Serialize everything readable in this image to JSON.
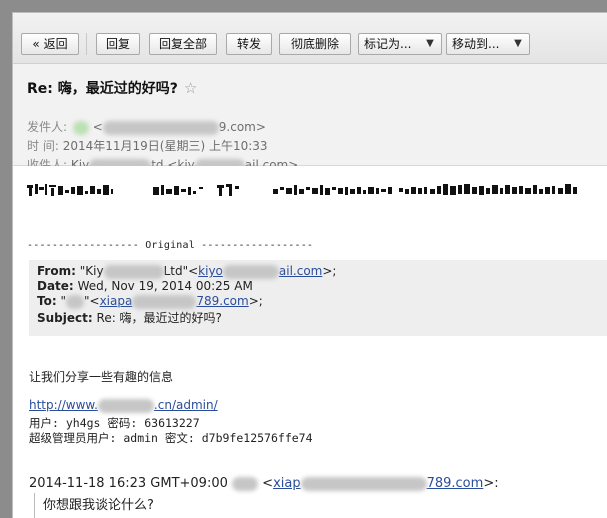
{
  "toolbar": {
    "back_label": "« 返回",
    "reply_label": "回复",
    "reply_all_label": "回复全部",
    "forward_label": "转发",
    "delete_label": "彻底删除",
    "mark_as_label": "标记为...",
    "move_to_label": "移动到..."
  },
  "header": {
    "subject": "Re: 嗨，最近过的好吗?",
    "star": "☆",
    "from_label": "发件人:",
    "from_value_start": "<",
    "from_value_end": "9.com>",
    "time_label": "时 间:",
    "time_value": "2014年11月19日(星期三) 上午10:33",
    "to_label": "收件人:",
    "to_value_a": "Kiy",
    "to_value_b": "td <kiy",
    "to_value_c": "ail.com>"
  },
  "body": {
    "original_divider": "------------------ Original ------------------",
    "quote": {
      "from_label": "From:",
      "from_a": "\"Kiy",
      "from_b": "Ltd\"<",
      "from_link_a": "kiyo",
      "from_link_b": "ail.com",
      "from_end": ">;",
      "date_label": "Date:",
      "date_value": "Wed, Nov 19, 2014 00:25 AM",
      "to_label": "To:",
      "to_a": "\"",
      "to_b": "\"<",
      "to_link_a": "xiapa",
      "to_link_b": "789.com",
      "to_end": ">;",
      "subject_label": "Subject:",
      "subject_value": "Re: 嗨，最近过的好吗?"
    },
    "share_line": "让我们分享一些有趣的信息",
    "url_a": "http://www.",
    "url_b": ".cn/admin/",
    "user_line": "用户: yh4gs 密码: 63613227",
    "admin_line": "超级管理员用户: admin 密文: d7b9fe12576ffe74",
    "reply_header_a": "2014-11-18 16:23 GMT+09:00",
    "reply_header_lt": "<",
    "reply_link_a": "xiap",
    "reply_link_b": "789.com",
    "reply_header_end": ">:",
    "reply_text": "你想跟我谈论什么?"
  }
}
